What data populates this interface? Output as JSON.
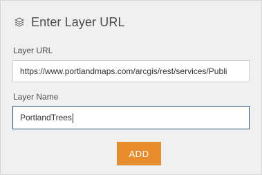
{
  "header": {
    "icon": "layers-icon",
    "title": "Enter Layer URL"
  },
  "form": {
    "url_label": "Layer URL",
    "url_value": "https://www.portlandmaps.com/arcgis/rest/services/Publi",
    "name_label": "Layer Name",
    "name_value": "PortlandTrees"
  },
  "actions": {
    "add_label": "ADD"
  },
  "colors": {
    "background": "#f0f0f0",
    "accent": "#e98c2c",
    "focus_border": "#2b4c7e"
  }
}
